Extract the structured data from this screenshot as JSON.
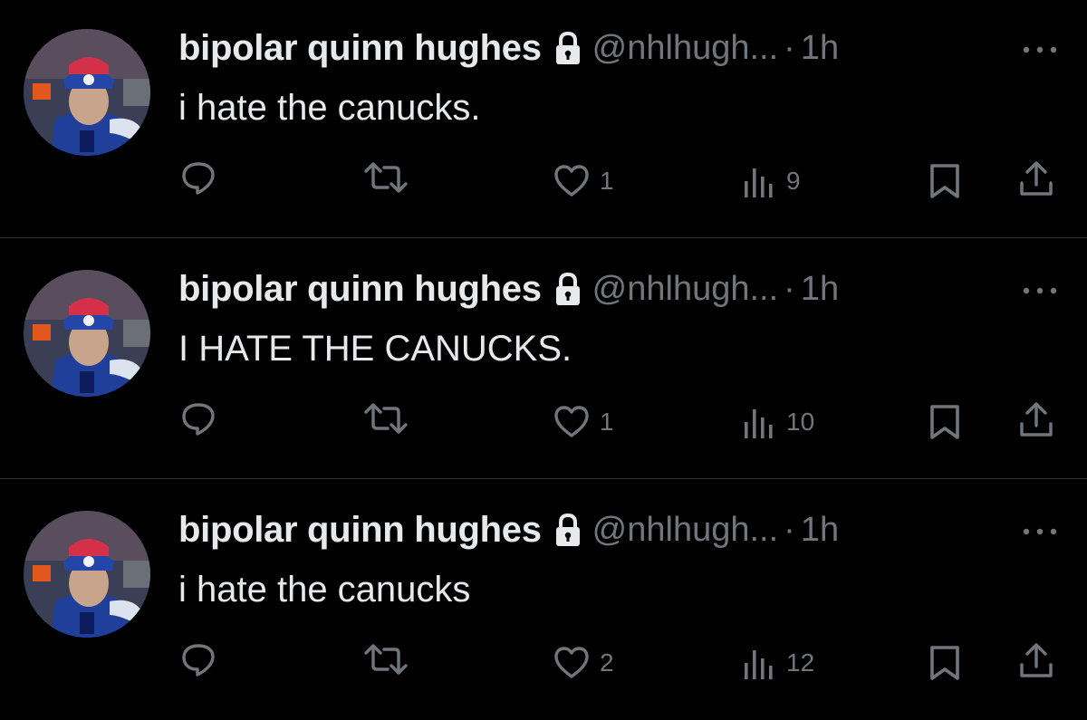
{
  "colors": {
    "background": "#000000",
    "text": "#e7e9ea",
    "muted": "#71767b",
    "divider": "#2f3336"
  },
  "tweets": [
    {
      "name": "bipolar quinn hughes",
      "handle": "@nhlhugh...",
      "separator": "·",
      "time": "1h",
      "text": "i hate the canucks.",
      "likes": "1",
      "views": "9"
    },
    {
      "name": "bipolar quinn hughes",
      "handle": "@nhlhugh...",
      "separator": "·",
      "time": "1h",
      "text": "I HATE THE CANUCKS.",
      "likes": "1",
      "views": "10"
    },
    {
      "name": "bipolar quinn hughes",
      "handle": "@nhlhugh...",
      "separator": "·",
      "time": "1h",
      "text": "i hate the canucks",
      "likes": "2",
      "views": "12"
    }
  ],
  "icons": {
    "verified_lock": "lock-icon",
    "more": "more-icon",
    "reply": "reply-icon",
    "retweet": "retweet-icon",
    "like": "heart-icon",
    "views": "views-icon",
    "bookmark": "bookmark-icon",
    "share": "share-icon"
  }
}
